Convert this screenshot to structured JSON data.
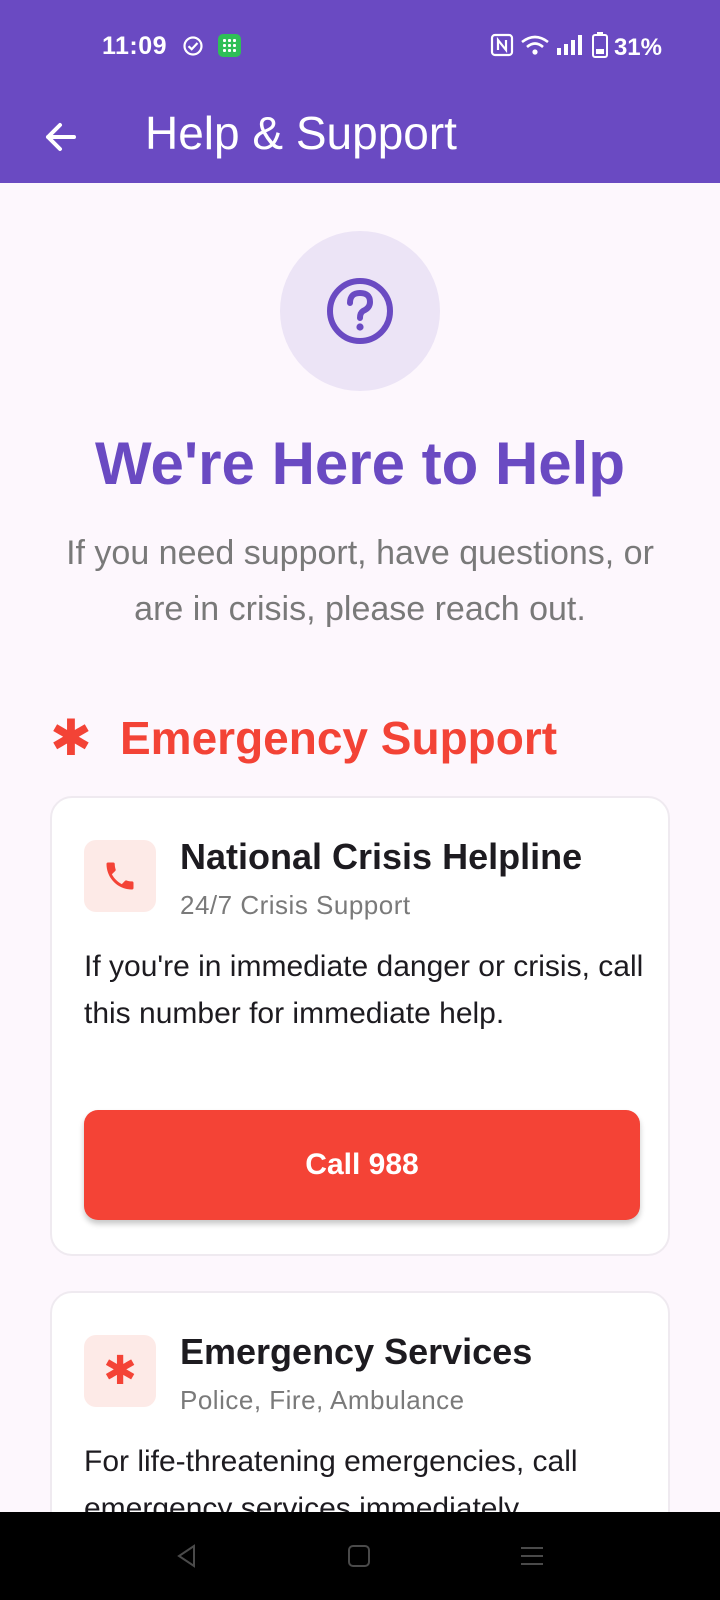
{
  "status_bar": {
    "time": "11:09",
    "battery": "31%"
  },
  "app_bar": {
    "title": "Help & Support",
    "back_icon": "arrow-back-icon"
  },
  "hero": {
    "icon": "help-circle-icon",
    "title": "We're Here to Help",
    "subtitle": "If you need support, have questions, or are in crisis, please reach out."
  },
  "section": {
    "icon": "asterisk-icon",
    "title": "Emergency Support"
  },
  "cards": [
    {
      "icon": "phone-icon",
      "title": "National Crisis Helpline",
      "subtitle": "24/7 Crisis Support",
      "description": "If you're in immediate danger or crisis, call this number for immediate help.",
      "button_label": "Call 988"
    },
    {
      "icon": "asterisk-icon",
      "title": "Emergency Services",
      "subtitle": "Police, Fire, Ambulance",
      "description": "For life-threatening emergencies, call emergency services immediately."
    }
  ],
  "colors": {
    "primary": "#6a4ac2",
    "emergency": "#f44336",
    "background": "#fdf7fd"
  }
}
